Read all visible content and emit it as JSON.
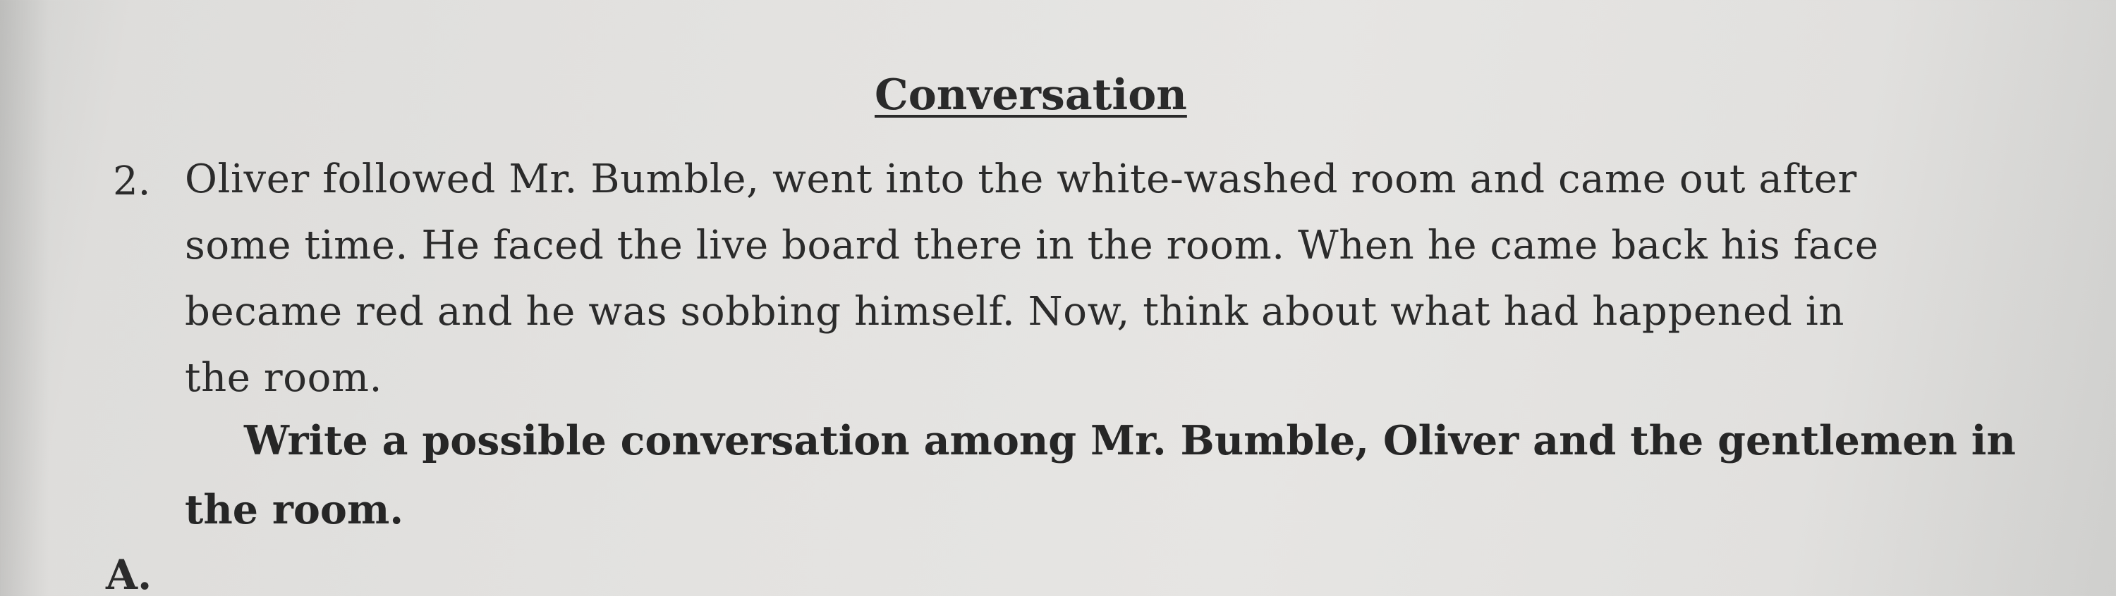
{
  "heading": "Conversation",
  "question": {
    "number": "2.",
    "lines": [
      "Oliver followed Mr. Bumble, went into the white-washed room and came out after",
      "some time. He faced the live board there in the room. When he came back his face",
      "became red and he was sobbing himself. Now, think about what had happened in",
      "the room."
    ],
    "instruction_lines": [
      "Write a possible conversation among Mr. Bumble, Oliver and the gentlemen in",
      "the room."
    ]
  },
  "answer_label": "A."
}
